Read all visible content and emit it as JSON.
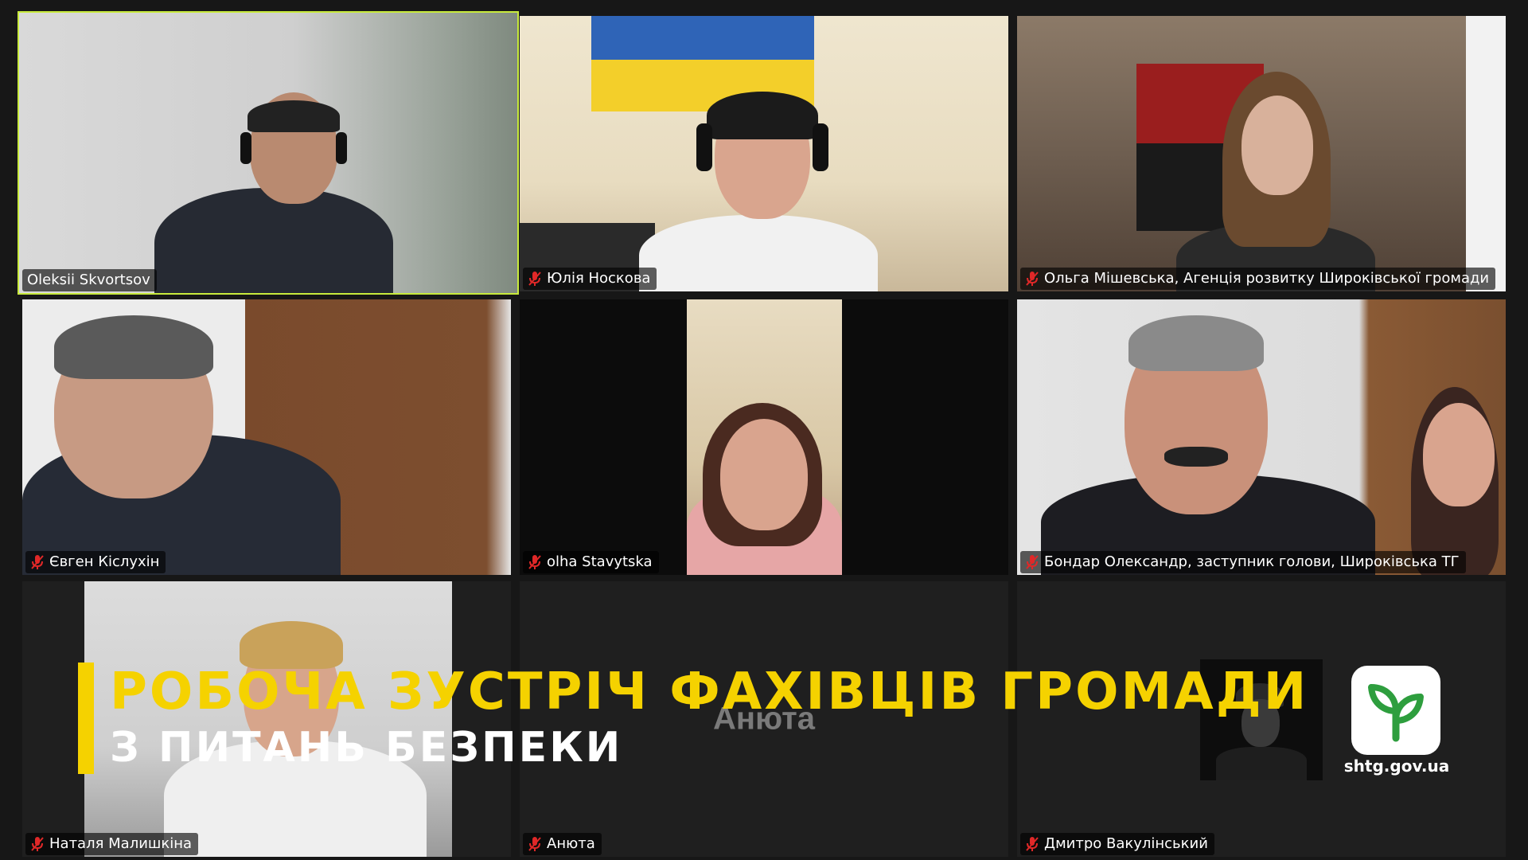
{
  "participants": [
    {
      "name": "Oleksii Skvortsov",
      "muted": false,
      "active": true
    },
    {
      "name": "Юлія Носкова",
      "muted": true
    },
    {
      "name": "Ольга Мішевська, Агенція розвитку Широківської громади",
      "muted": true
    },
    {
      "name": "Євген Кіслухін",
      "muted": true
    },
    {
      "name": "olha Stavytska",
      "muted": true
    },
    {
      "name": "Бондар Олександр, заступник голови, Широківська ТГ",
      "muted": true
    },
    {
      "name": "Наталя Малишкіна",
      "muted": true
    },
    {
      "name": "Анюта",
      "muted": true,
      "center_label": "Анюта"
    },
    {
      "name": "Дмитро Вакулінський",
      "muted": true
    }
  ],
  "banner": {
    "line1": "РОБОЧА ЗУСТРІЧ ФАХІВЦІВ ГРОМАДИ",
    "line2": "З ПИТАНЬ БЕЗПЕКИ"
  },
  "logo": {
    "url": "shtg.gov.ua",
    "color": "#2e9e3e"
  },
  "colors": {
    "accent": "#f5d200",
    "active_border": "#c8ea3c",
    "mic_off": "#e02828"
  }
}
